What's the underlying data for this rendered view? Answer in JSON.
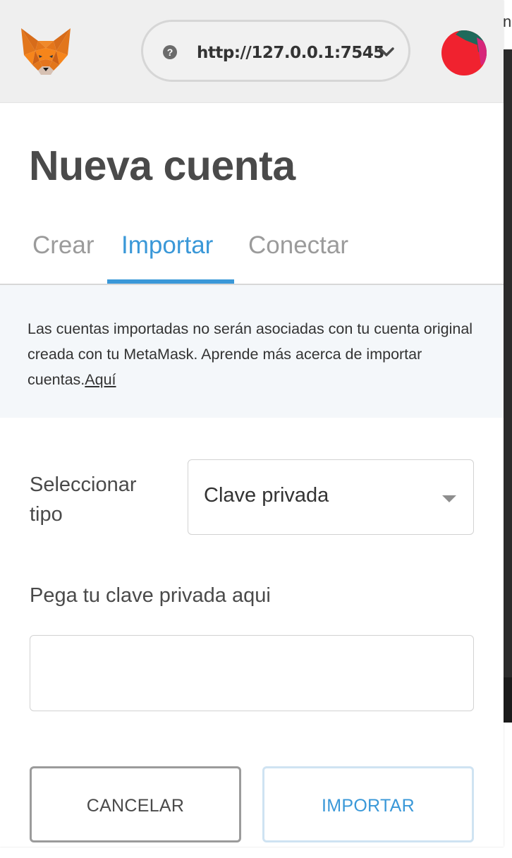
{
  "header": {
    "network_url": "http://127.0.0.1:7545",
    "help_glyph": "?"
  },
  "page": {
    "title": "Nueva cuenta"
  },
  "tabs": [
    {
      "label": "Crear",
      "active": false
    },
    {
      "label": "Importar",
      "active": true
    },
    {
      "label": "Conectar",
      "active": false
    }
  ],
  "notice": {
    "text": "Las cuentas importadas no serán asociadas con tu cuenta original creada con tu MetaMask. Aprende más acerca de importar cuentas.",
    "link": "Aquí"
  },
  "form": {
    "select_label": "Seleccionar tipo",
    "select_value": "Clave privada",
    "paste_label": "Pega tu clave privada aqui",
    "paste_value": "",
    "paste_placeholder": ""
  },
  "buttons": {
    "cancel": "CANCELAR",
    "import": "IMPORTAR"
  },
  "edge": {
    "letter": "n"
  },
  "colors": {
    "accent": "#3a98d8",
    "header_bg": "#efefef",
    "notice_bg": "#f4f7fa"
  }
}
